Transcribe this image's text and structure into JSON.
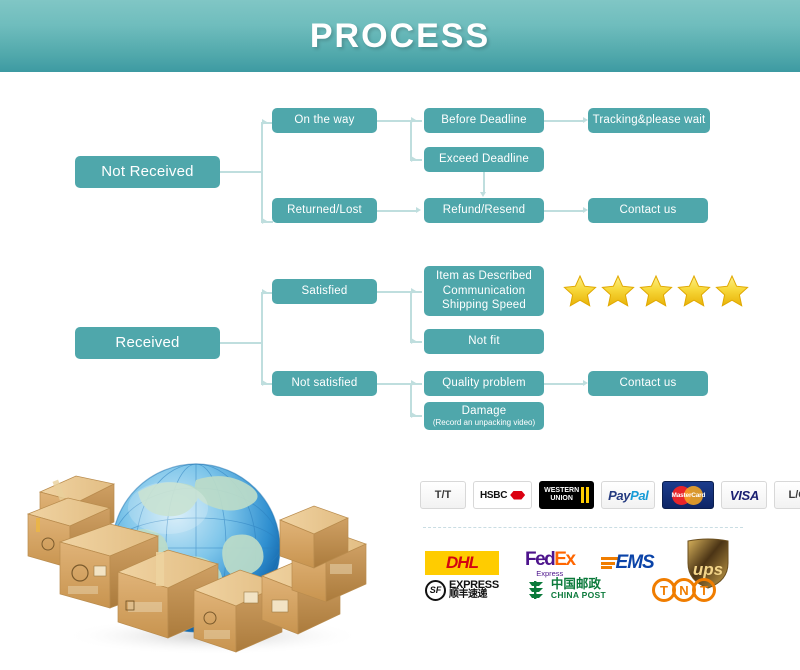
{
  "header": {
    "title": "PROCESS"
  },
  "flow": {
    "not_received": {
      "root": "Not Received",
      "on_the_way": "On the way",
      "before_deadline": "Before Deadline",
      "tracking": "Tracking&please wait",
      "exceed_deadline": "Exceed Deadline",
      "returned_lost": "Returned/Lost",
      "refund_resend": "Refund/Resend",
      "contact_us": "Contact us"
    },
    "received": {
      "root": "Received",
      "satisfied": "Satisfied",
      "item_described_l1": "Item as Described",
      "item_described_l2": "Communication",
      "item_described_l3": "Shipping Speed",
      "not_fit": "Not fit",
      "not_satisfied": "Not satisfied",
      "quality_problem": "Quality problem",
      "contact_us": "Contact us",
      "damage": "Damage",
      "damage_sub": "(Record an unpacking video)"
    },
    "rating_stars": 5
  },
  "payments": [
    {
      "id": "tt",
      "label": "T/T"
    },
    {
      "id": "hsbc",
      "label": "HSBC"
    },
    {
      "id": "western-union",
      "label": "WESTERN UNION"
    },
    {
      "id": "paypal",
      "label": "PayPal"
    },
    {
      "id": "mastercard",
      "label": "MasterCard"
    },
    {
      "id": "visa",
      "label": "VISA"
    },
    {
      "id": "lc",
      "label": "L/C"
    }
  ],
  "payment_text": {
    "tt": "T/T",
    "hsbc": "HSBC",
    "wu_line1": "WESTERN",
    "wu_line2": "UNION",
    "paypal_a": "Pay",
    "paypal_b": "Pal",
    "mastercard": "MasterCard",
    "visa": "VISA",
    "lc": "L/C"
  },
  "shipping": {
    "dhl": "DHL",
    "fedex_a": "Fed",
    "fedex_b": "Ex",
    "fedex_sub": "Express",
    "ems": "EMS",
    "ups": "ups",
    "sf_badge": "SF",
    "sf_line1": "EXPRESS",
    "sf_line2": "顺丰速递",
    "china_post_cn": "中国邮政",
    "china_post_en": "CHINA POST",
    "tnt_t1": "T",
    "tnt_n": "N",
    "tnt_t2": "T"
  },
  "illustration": {
    "name": "globe-with-shipping-boxes"
  },
  "colors": {
    "header_top": "#80c6c5",
    "header_bottom": "#3d9aa2",
    "node": "#4fa7ab",
    "connector": "#bfdede",
    "star": "#f5d020"
  }
}
